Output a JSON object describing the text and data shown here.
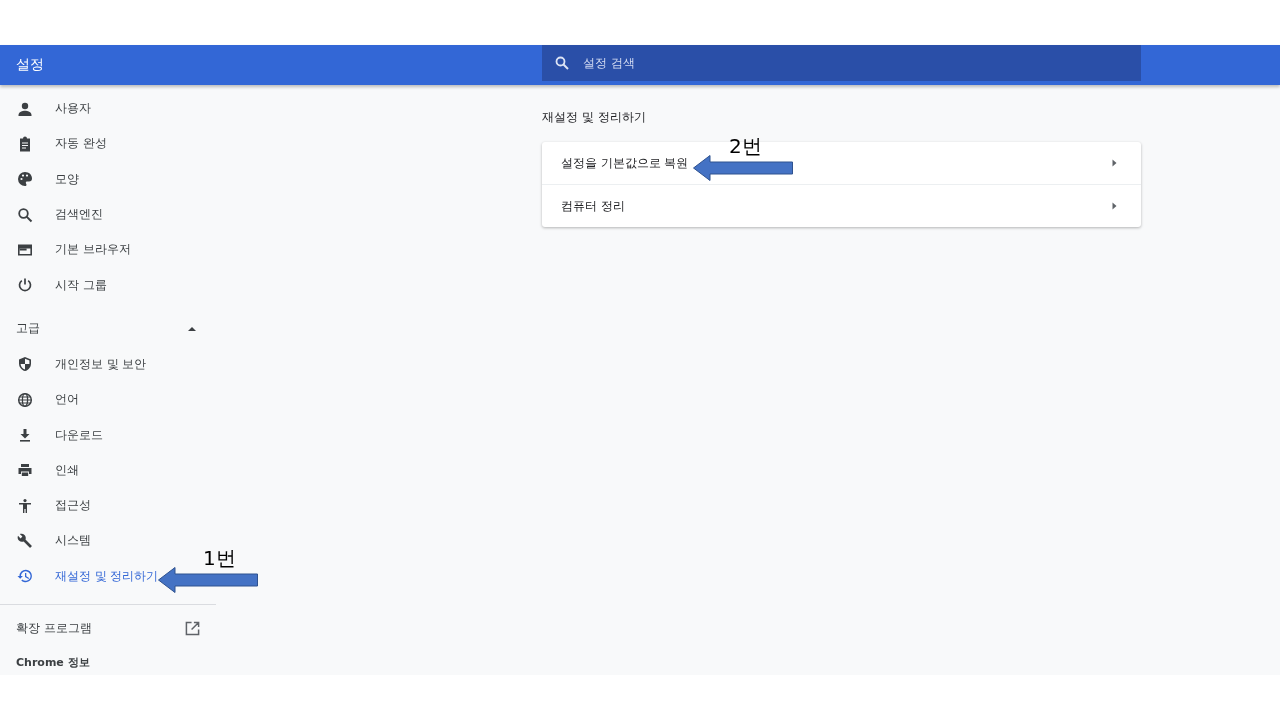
{
  "header": {
    "title": "설정",
    "search": {
      "placeholder": "설정 검색"
    }
  },
  "sidebar": {
    "items": [
      {
        "label": "사용자",
        "selected": false
      },
      {
        "label": "자동 완성",
        "selected": false
      },
      {
        "label": "모양",
        "selected": false
      },
      {
        "label": "검색엔진",
        "selected": false
      },
      {
        "label": "기본 브라우저",
        "selected": false
      },
      {
        "label": "시작 그룹",
        "selected": false
      }
    ],
    "advanced": {
      "label": "고급",
      "expanded": true,
      "items": [
        {
          "label": "개인정보 및 보안",
          "selected": false
        },
        {
          "label": "언어",
          "selected": false
        },
        {
          "label": "다운로드",
          "selected": false
        },
        {
          "label": "인쇄",
          "selected": false
        },
        {
          "label": "접근성",
          "selected": false
        },
        {
          "label": "시스템",
          "selected": false
        },
        {
          "label": "재설정 및 정리하기",
          "selected": true
        }
      ]
    },
    "extensions": "확장 프로그램",
    "about": "Chrome 정보"
  },
  "main": {
    "section_title": "재설정 및 정리하기",
    "rows": [
      {
        "label": "설정을 기본값으로 복원"
      },
      {
        "label": "컴퓨터 정리"
      }
    ]
  },
  "annotations": [
    {
      "label": "1번"
    },
    {
      "label": "2번"
    }
  ]
}
